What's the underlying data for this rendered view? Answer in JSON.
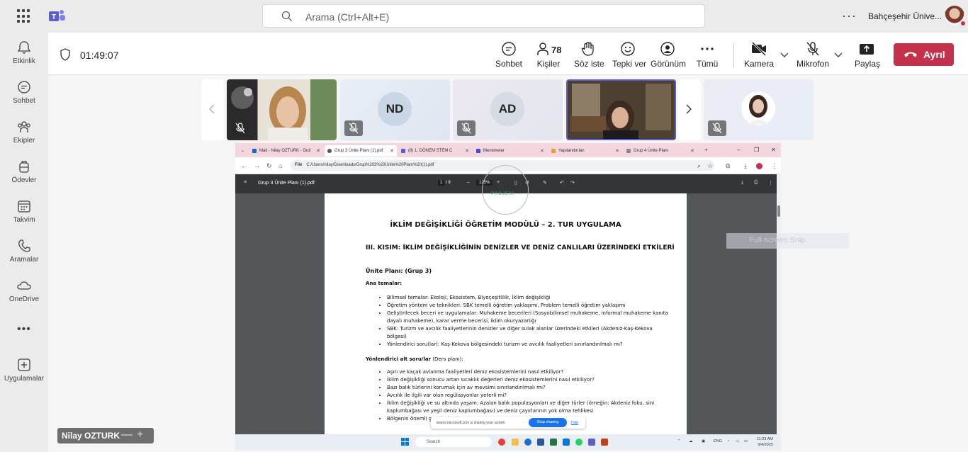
{
  "search": {
    "placeholder": "Arama (Ctrl+Alt+E)"
  },
  "org": {
    "name": "Bahçeşehir Ünive..."
  },
  "rail": {
    "items": [
      {
        "label": "Etkinlik"
      },
      {
        "label": "Sohbet"
      },
      {
        "label": "Ekipler"
      },
      {
        "label": "Ödevler"
      },
      {
        "label": "Takvim"
      },
      {
        "label": "Aramalar"
      },
      {
        "label": "OneDrive"
      },
      {
        "label": "Uygulamalar"
      }
    ],
    "more": "•••"
  },
  "meeting": {
    "timer": "01:49:07",
    "people_count": "78",
    "toolbar": {
      "chat": "Sohbet",
      "people": "Kişiler",
      "raise_hand": "Söz iste",
      "react": "Tepki ver",
      "view": "Görünüm",
      "more": "Tümü",
      "camera": "Kamera",
      "mic": "Mikrofon",
      "share": "Paylaş",
      "leave": "Ayrıl"
    }
  },
  "gallery": {
    "tiles": [
      {
        "initials": ""
      },
      {
        "initials": "ND"
      },
      {
        "initials": "AD"
      },
      {
        "initials": ""
      },
      {
        "initials": ""
      }
    ]
  },
  "browser": {
    "tabs": [
      {
        "label": "Mail - Nilay OZTURK - Outl"
      },
      {
        "label": "Grup 3 Ünite Planı (1).pdf"
      },
      {
        "label": "(8) 1. DÖNEM STEM C"
      },
      {
        "label": "Mentimeter"
      },
      {
        "label": "Yapılandırılan"
      },
      {
        "label": "Grup 4 Ünite Planı"
      }
    ],
    "url_scheme": "File",
    "url": "C:/Users/nilay/Downloads/Grup%203%20Ünite%20Planı%20(1).pdf"
  },
  "pdf": {
    "filename": "Grup 3 Ünite Planı (1).pdf",
    "page_current": "1",
    "page_sep": "/",
    "page_total": "9",
    "zoom": "125%",
    "logo_text": "PROJESİ",
    "title": "İKLİM DEĞİŞİKLİĞİ ÖĞRETİM MODÜLÜ – 2. TUR UYGULAMA",
    "section": "III. KISIM: İKLİM DEĞİŞİKLİĞİNİN DENİZLER VE DENİZ CANLILARI ÜZERİNDEKİ ETKİLERİ",
    "unit_plan": "Ünite Planı: (Grup  3)",
    "themes_heading": "Ana temalar:",
    "themes": [
      "Bilimsel temalar: Ekoloji, Ekosistem, Biyoçeşitlilik, İklim değişikliği",
      "Öğretim yöntem ve teknikleri: SBK temelli öğretim yaklaşımı, Problem temelli öğretim yaklaşımı",
      "Geliştirilecek beceri ve uygulamalar: Muhakeme becerileri (Sosyobilimsel muhakeme, informal muhakeme kanıta dayalı muhakeme), karar verme becerisi, iklim okuryazarlığı",
      "SBK:  Turizm ve avcılık faaliyetlerinin denizler ve diğer sulak alanlar üzerindeki etkileri (Akdeniz-Kaş-Kekova bölgesi)",
      "Yönlendirici soru(lar): Kaş-Kekova bölgesindeki turizm ve avcılık  faaliyetleri sınırlandırılmalı mı?"
    ],
    "sub_heading": "Yönlendirici alt soru/lar",
    "sub_heading_note": " (Ders planı):",
    "sub_questions": [
      "Aşırı ve kaçak avlanma faaliyetleri deniz ekosistemlerini nasıl etkiliyor?",
      "İklim değişikliği sonucu artan sıcaklık değerleri deniz ekosistemlerini nasıl etkiliyor?",
      "Bazı balık türlerini korumak için av mevsimi sınırlandırılmalı mı?",
      "Avcılık ile ilgili var olan regülasyonlar yeterli mi?",
      "İklim değişikliği ve su altında yaşam: Azalan balık populasyonları ve diğer türler (örneğin: Akdeniz foku, sini kaplumbağası ve yeşil deniz kaplumbağası) ve deniz çayırlarının yok olma tehlikesi",
      "Bölgenin önemli g                                                              andırılmalı mı?"
    ]
  },
  "share_notice": {
    "message": "teams.microsoft.com is sharing your screen.",
    "stop": "Stop sharing",
    "hide": "Hide"
  },
  "taskbar": {
    "search": "Search",
    "lang": "ENG",
    "time": "11:23 AM",
    "date": "9/4/2025"
  },
  "snip": {
    "label": "Full-screen Snip"
  },
  "presenter": {
    "name": "Nilay OZTURK"
  },
  "colors": {
    "leave": "#c4314b",
    "accent": "#5b5fc7",
    "teams_brand": "#5b5fc7"
  }
}
